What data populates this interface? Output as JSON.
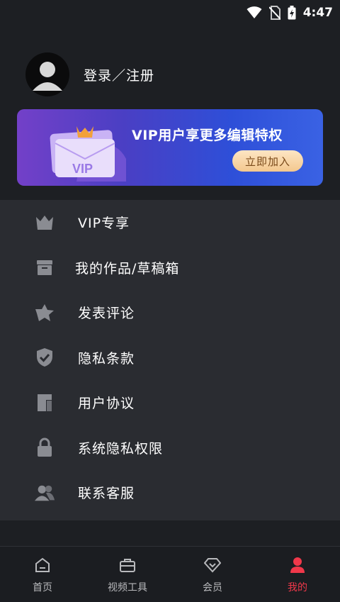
{
  "status_bar": {
    "time": "4:47",
    "icons": [
      "wifi-icon",
      "no-sim-icon",
      "battery-charging-icon"
    ]
  },
  "profile": {
    "login_label": "登录／注册",
    "avatar_icon": "user-avatar-icon"
  },
  "vip_banner": {
    "title": "VIP用户享更多编辑特权",
    "button_label": "立即加入",
    "card_text": "VIP"
  },
  "menu": {
    "items": [
      {
        "label": "VIP专享",
        "icon": "crown-icon"
      },
      {
        "label": "我的作品/草稿箱",
        "icon": "archive-box-icon"
      },
      {
        "label": "发表评论",
        "icon": "comment-star-icon"
      },
      {
        "label": "隐私条款",
        "icon": "shield-check-icon"
      },
      {
        "label": "用户协议",
        "icon": "document-icon"
      },
      {
        "label": "系统隐私权限",
        "icon": "lock-icon"
      },
      {
        "label": "联系客服",
        "icon": "contacts-icon"
      }
    ]
  },
  "tabbar": {
    "tabs": [
      {
        "label": "首页",
        "icon": "home-icon",
        "active": false
      },
      {
        "label": "视频工具",
        "icon": "toolbox-icon",
        "active": false
      },
      {
        "label": "会员",
        "icon": "diamond-icon",
        "active": false
      },
      {
        "label": "我的",
        "icon": "person-icon",
        "active": true
      }
    ]
  },
  "colors": {
    "background": "#1d1f23",
    "menu_background": "#2a2c31",
    "accent_active": "#f0384a",
    "vip_button": "#f3c88e"
  }
}
